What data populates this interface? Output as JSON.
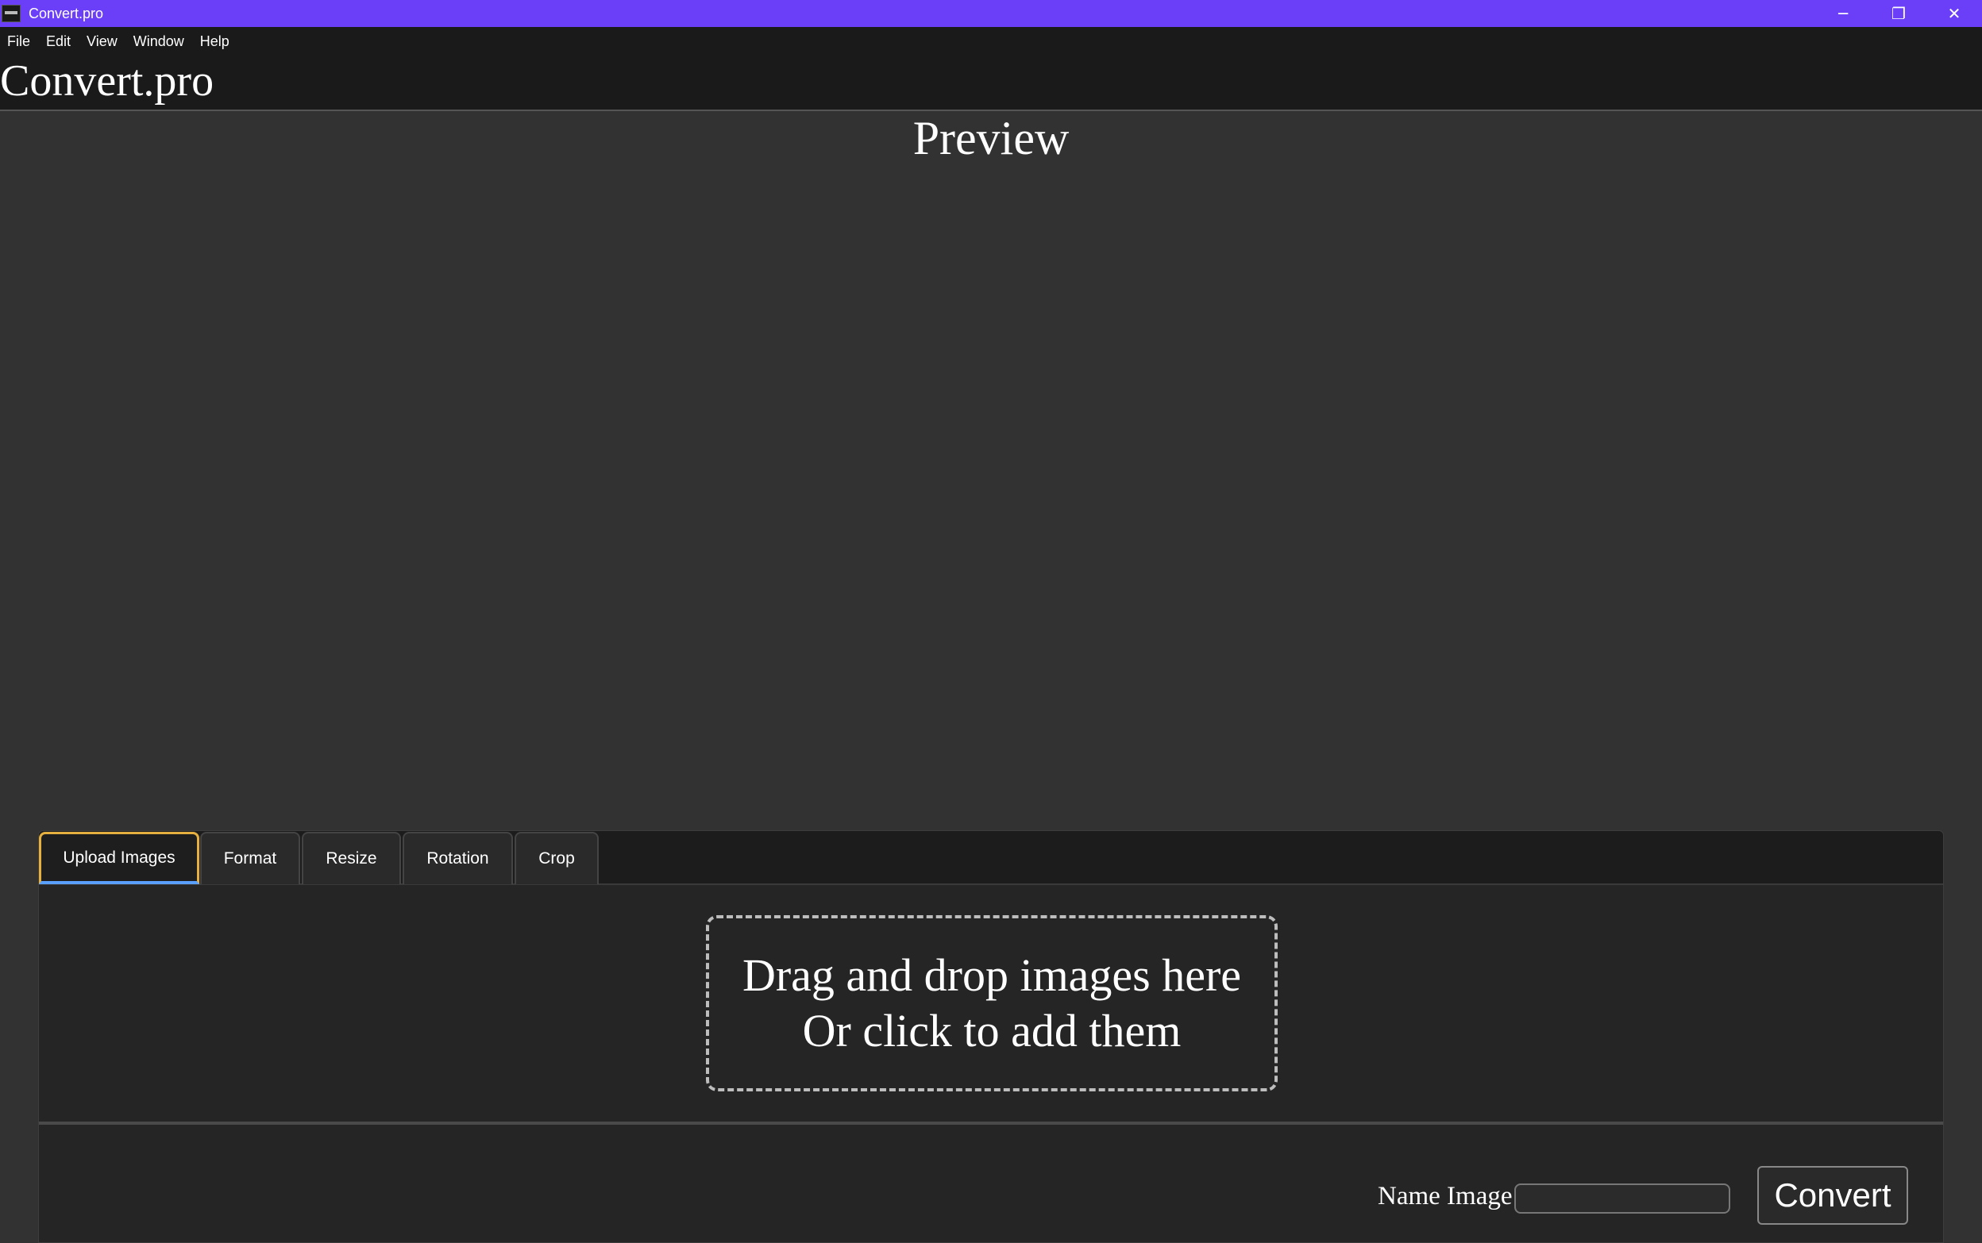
{
  "window": {
    "title": "Convert.pro",
    "controls": {
      "minimize": "─",
      "restore": "❐",
      "close": "✕"
    }
  },
  "menu": {
    "items": [
      "File",
      "Edit",
      "View",
      "Window",
      "Help"
    ]
  },
  "header": {
    "app_title": "Convert.pro"
  },
  "preview": {
    "title": "Preview"
  },
  "tabs": [
    {
      "label": "Upload Images",
      "active": true
    },
    {
      "label": "Format",
      "active": false
    },
    {
      "label": "Resize",
      "active": false
    },
    {
      "label": "Rotation",
      "active": false
    },
    {
      "label": "Crop",
      "active": false
    }
  ],
  "dropzone": {
    "line1": "Drag and drop images here",
    "line2": "Or click to add them"
  },
  "footer": {
    "name_label": "Name Image",
    "name_value": "",
    "convert_label": "Convert"
  },
  "colors": {
    "titlebar": "#6a3ff7",
    "background": "#323232",
    "active_tab_border": "#e6b040",
    "active_tab_underline": "#5aa0ff"
  }
}
